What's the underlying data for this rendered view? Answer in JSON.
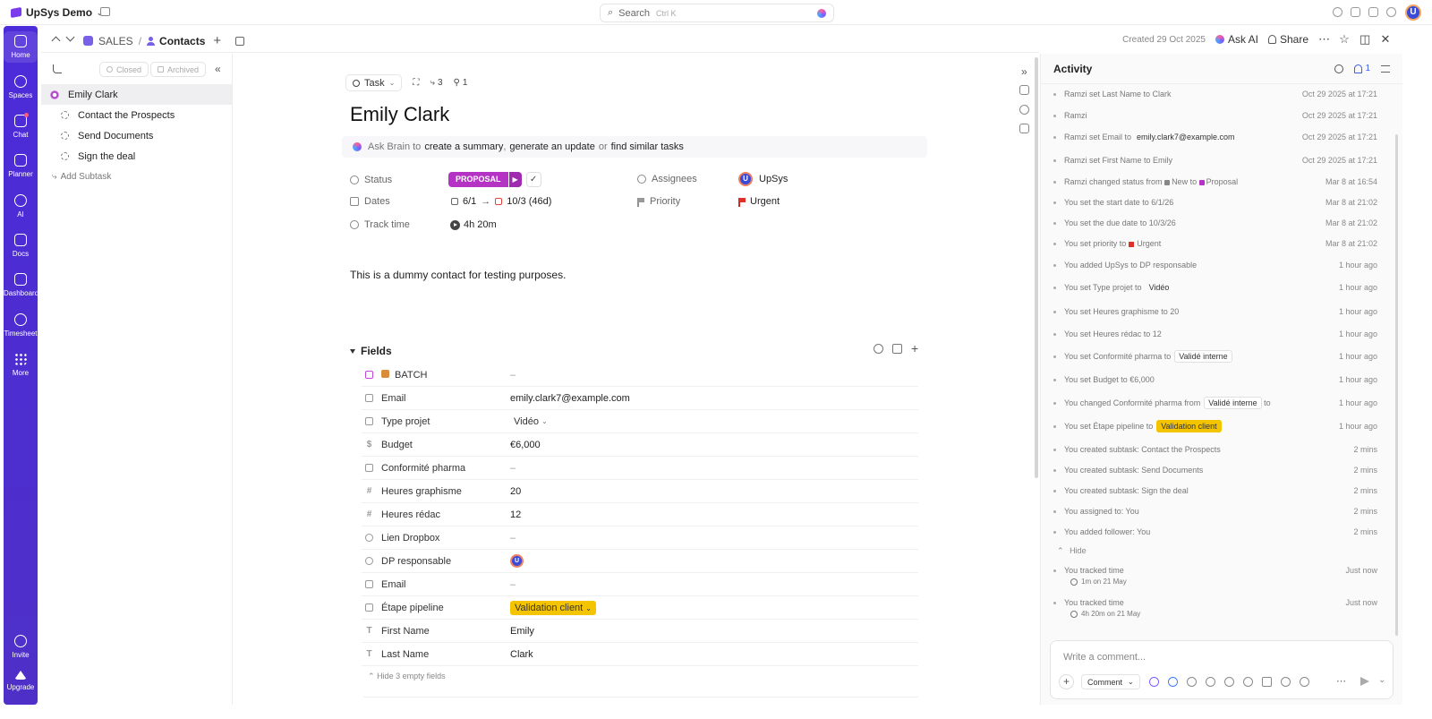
{
  "workspace": {
    "name": "UpSys Demo"
  },
  "search": {
    "placeholder": "Search",
    "shortcut": "Ctrl K"
  },
  "user_avatar_initial": "U",
  "rail": [
    {
      "label": "Home",
      "icon": "home-icon"
    },
    {
      "label": "Spaces",
      "icon": "spaces-icon"
    },
    {
      "label": "Chat",
      "icon": "chat-icon"
    },
    {
      "label": "Planner",
      "icon": "planner-icon"
    },
    {
      "label": "AI",
      "icon": "ai-icon"
    },
    {
      "label": "Docs",
      "icon": "docs-icon"
    },
    {
      "label": "Dashboard",
      "icon": "dashboard-icon"
    },
    {
      "label": "Timesheet",
      "icon": "clock-icon"
    },
    {
      "label": "More",
      "icon": "grid-icon"
    }
  ],
  "rail_bottom": {
    "invite": "Invite",
    "upgrade": "Upgrade"
  },
  "breadcrumb": {
    "space": "SALES",
    "sep": "/",
    "list": "Contacts",
    "plus": "+"
  },
  "header": {
    "created": "Created 29 Oct 2025",
    "ask_ai": "Ask AI",
    "share": "Share",
    "more": "⋯"
  },
  "subtasks_panel": {
    "closed_label": "Closed",
    "archived_label": "Archived",
    "collapse": "«",
    "parent": "Emily Clark",
    "items": [
      "Contact the Prospects",
      "Send Documents",
      "Sign the deal"
    ],
    "add_label": "Add Subtask"
  },
  "task": {
    "type": "Task",
    "meta_subtask_count": "3",
    "meta_dep_count": "1",
    "title": "Emily Clark",
    "brain": {
      "prefix": "Ask Brain to",
      "link1": "create a summary",
      "sep1": ",",
      "link2": "generate an update",
      "or": "or",
      "link3": "find similar tasks"
    },
    "status_label": "Status",
    "status_value": "PROPOSAL",
    "dates_label": "Dates",
    "start_date": "6/1",
    "arrow": "→",
    "due_date": "10/3 (46d)",
    "track_label": "Track time",
    "track_value": "4h 20m",
    "assignees_label": "Assignees",
    "assignee_name": "UpSys",
    "assignee_initial": "U",
    "priority_label": "Priority",
    "priority_value": "Urgent",
    "description": "This is a dummy contact for testing purposes."
  },
  "fields": {
    "heading": "Fields",
    "rows": [
      {
        "label": "BATCH",
        "value": "–"
      },
      {
        "label": "Email",
        "value": "emily.clark7@example.com"
      },
      {
        "label": "Type projet",
        "value": "Vidéo"
      },
      {
        "label": "Budget",
        "value": "€6,000"
      },
      {
        "label": "Conformité pharma",
        "value": "–"
      },
      {
        "label": "Heures graphisme",
        "value": "20"
      },
      {
        "label": "Heures rédac",
        "value": "12"
      },
      {
        "label": "Lien Dropbox",
        "value": "–"
      },
      {
        "label": "DP responsable",
        "value": "U"
      },
      {
        "label": "Email",
        "value": "–"
      },
      {
        "label": "Étape pipeline",
        "value": "Validation client"
      },
      {
        "label": "First Name",
        "value": "Emily"
      },
      {
        "label": "Last Name",
        "value": "Clark"
      }
    ],
    "hide_empty": "Hide 3 empty fields"
  },
  "activity": {
    "title": "Activity",
    "notif_count": "1",
    "entries": [
      {
        "text": "Ramzi set Last Name to Clark",
        "time": "Oct 29 2025 at 17:21"
      },
      {
        "text": "Ramzi",
        "time": "Oct 29 2025 at 17:21"
      },
      {
        "text": "Ramzi set Email to",
        "chip": "emily.clark7@example.com",
        "time": "Oct 29 2025 at 17:21"
      },
      {
        "text": "Ramzi set First Name to Emily",
        "time": "Oct 29 2025 at 17:21"
      },
      {
        "text": "Ramzi changed status from",
        "from": "New",
        "mid": "to",
        "to": "Proposal",
        "time": "Mar 8 at 16:54"
      },
      {
        "text": "You set the start date to 6/1/26",
        "time": "Mar 8 at 21:02"
      },
      {
        "text": "You set the due date to 10/3/26",
        "time": "Mar 8 at 21:02"
      },
      {
        "text": "You set priority to",
        "flagtext": "Urgent",
        "time": "Mar 8 at 21:02"
      },
      {
        "text": "You added UpSys to DP responsable",
        "time": "1 hour ago"
      },
      {
        "text": "You set Type projet to",
        "chip": "Vidéo",
        "time": "1 hour ago"
      },
      {
        "text": "You set Heures graphisme to 20",
        "time": "1 hour ago"
      },
      {
        "text": "You set Heures rédac to 12",
        "time": "1 hour ago"
      },
      {
        "text": "You set Conformité pharma to",
        "chip": "Validé interne",
        "time": "1 hour ago"
      },
      {
        "text": "You set Budget to €6,000",
        "time": "1 hour ago"
      },
      {
        "text": "You changed Conformité pharma from",
        "chip": "Validé interne",
        "suffix": "to",
        "time": "1 hour ago"
      },
      {
        "text": "You set Étape pipeline to",
        "ychip": "Validation client",
        "time": "1 hour ago"
      },
      {
        "text": "You created subtask: Contact the Prospects",
        "time": "2 mins"
      },
      {
        "text": "You created subtask: Send Documents",
        "time": "2 mins"
      },
      {
        "text": "You created subtask: Sign the deal",
        "time": "2 mins"
      },
      {
        "text": "You assigned to: You",
        "time": "2 mins"
      },
      {
        "text": "You added follower: You",
        "time": "2 mins"
      }
    ],
    "hide_label": "Hide",
    "tracked": [
      {
        "text": "You tracked time",
        "sub": "1m on 21 May",
        "time": "Just now"
      },
      {
        "text": "You tracked time",
        "sub": "4h 20m on 21 May",
        "time": "Just now"
      }
    ],
    "comment_placeholder": "Write a comment...",
    "comment_type": "Comment"
  },
  "colors": {
    "rail": "#4c2bd9",
    "status": "#b432c4",
    "pipeline": "#f4c400",
    "priority": "#e0302a"
  }
}
